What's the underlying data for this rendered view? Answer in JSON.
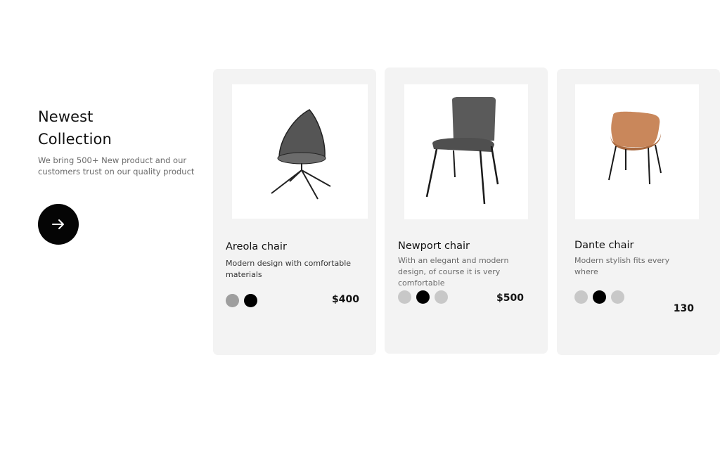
{
  "intro": {
    "title_line1": "Newest",
    "title_line2": "Collection",
    "text_line1": "We bring 500+ New product and our",
    "text_line2": "customers trust on our quality product",
    "arrow_icon": "arrow-right-icon"
  },
  "products": [
    {
      "name": "Areola chair",
      "desc_line1": "Modern design with comfortable",
      "desc_line2": "materials",
      "desc_line3": "",
      "price": "$400",
      "swatches": [
        "#9e9e9e",
        "#000000"
      ]
    },
    {
      "name": "Newport chair",
      "desc_line1": "With an elegant and modern",
      "desc_line2": "design, of course it is very",
      "desc_line3": "comfortable",
      "price": "$500",
      "swatches": [
        "#c8c8c8",
        "#000000",
        "#c8c8c8"
      ]
    },
    {
      "name": "Dante chair",
      "desc_line1": "Modern stylish fits every",
      "desc_line2": "where",
      "desc_line3": "",
      "price": "130",
      "swatches": [
        "#c8c8c8",
        "#000000",
        "#c8c8c8"
      ]
    }
  ]
}
